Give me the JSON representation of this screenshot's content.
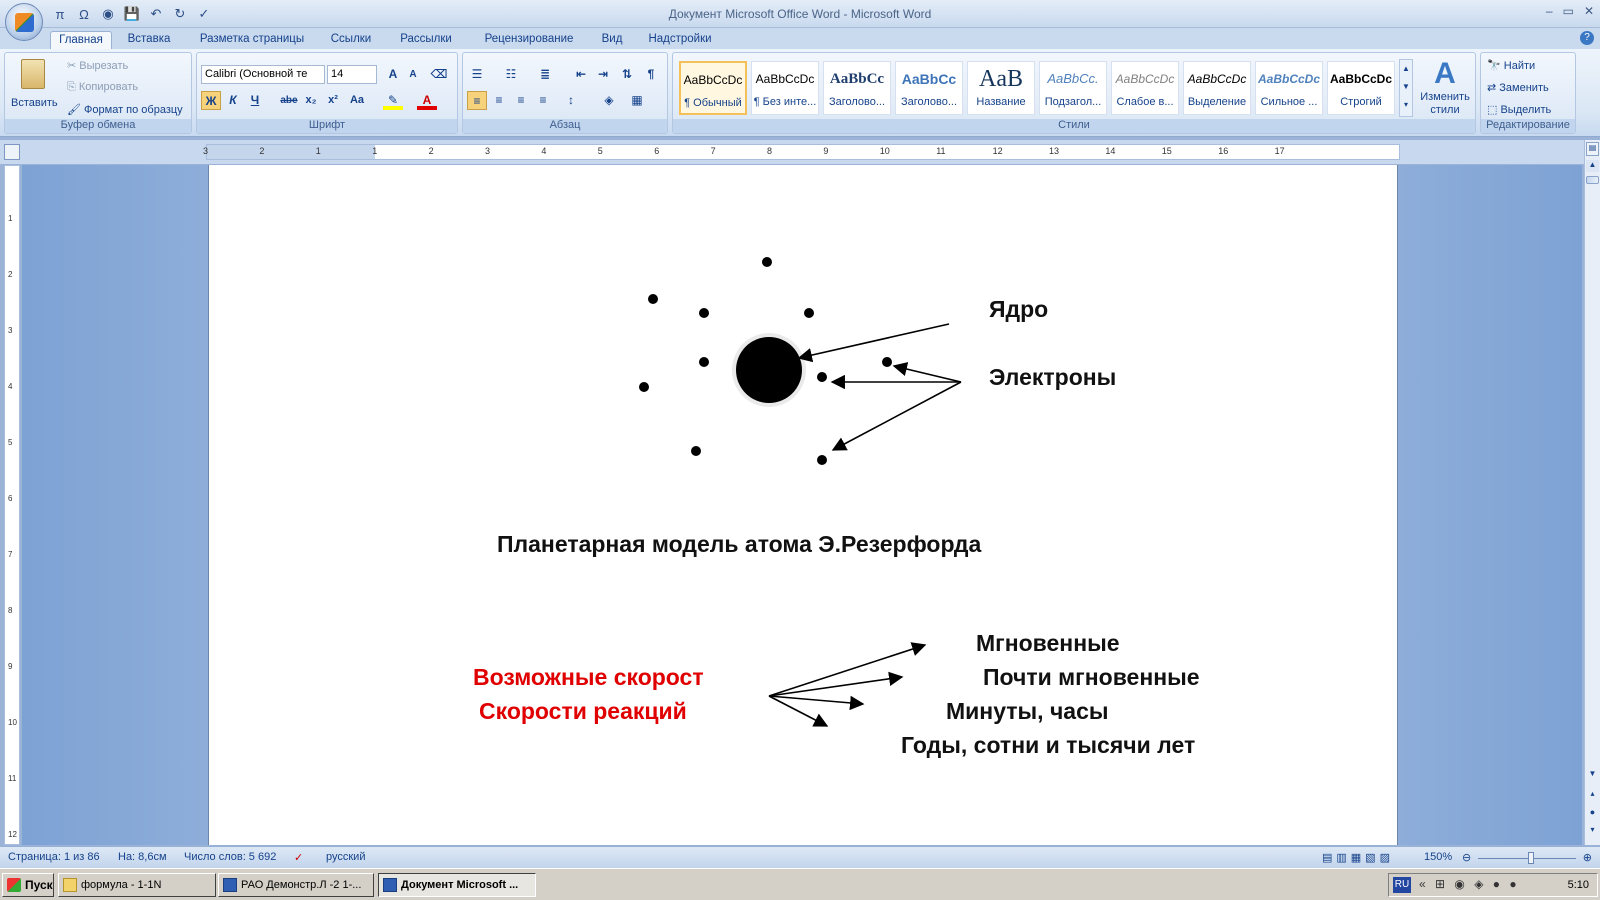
{
  "window": {
    "title": "Документ Microsoft Office Word - Microsoft Word",
    "controls": [
      "–",
      "▭",
      "✕"
    ]
  },
  "quick_access": [
    "π",
    "Ω",
    "◉",
    "💾",
    "↶",
    "↻",
    "✓"
  ],
  "tabs": [
    "Главная",
    "Вставка",
    "Разметка страницы",
    "Ссылки",
    "Рассылки",
    "Рецензирование",
    "Вид",
    "Надстройки"
  ],
  "ribbon": {
    "clipboard": {
      "paste": "Вставить",
      "cut": "Вырезать",
      "copy": "Копировать",
      "format_painter": "Формат по образцу",
      "label": "Буфер обмена"
    },
    "font": {
      "name": "Calibri (Основной те",
      "size": "14",
      "label": "Шрифт",
      "bold": "Ж",
      "italic": "К",
      "underline": "Ч",
      "strike": "abe",
      "sub": "x₂",
      "sup": "x²",
      "case": "Aa",
      "grow": "A",
      "shrink": "A"
    },
    "paragraph": {
      "label": "Абзац"
    },
    "styles": {
      "label": "Стили",
      "tiles": [
        {
          "sample": "AaBbCcDc",
          "name": "¶ Обычный"
        },
        {
          "sample": "AaBbCcDc",
          "name": "¶ Без инте..."
        },
        {
          "sample": "AaBbCc",
          "name": "Заголово..."
        },
        {
          "sample": "AaBbCc",
          "name": "Заголово..."
        },
        {
          "sample": "AaB",
          "name": "Название"
        },
        {
          "sample": "AaBbCc.",
          "name": "Подзагол..."
        },
        {
          "sample": "AaBbCcDc",
          "name": "Слабое в..."
        },
        {
          "sample": "AaBbCcDc",
          "name": "Выделение"
        },
        {
          "sample": "AaBbCcDc",
          "name": "Сильное ..."
        },
        {
          "sample": "AaBbCcDc",
          "name": "Строгий"
        }
      ],
      "change": "Изменить стили"
    },
    "editing": {
      "find": "Найти",
      "replace": "Заменить",
      "select": "Выделить",
      "label": "Редактирование"
    }
  },
  "ruler": {
    "h_numbers": [
      "3",
      "2",
      "1",
      "1",
      "2",
      "3",
      "4",
      "5",
      "6",
      "7",
      "8",
      "9",
      "10",
      "11",
      "12",
      "13",
      "14",
      "15",
      "16",
      "17"
    ],
    "v_numbers": [
      "1",
      "2",
      "3",
      "4",
      "5",
      "6",
      "7",
      "8",
      "9",
      "10",
      "11",
      "12"
    ]
  },
  "document": {
    "nucleus_label": "Ядро",
    "electrons_label": "Электроны",
    "caption": "Планетарная модель атома Э.Резерфорда",
    "red_line1": "Возможные скорост",
    "red_line2": "Скорости реакций",
    "speed1": "Мгновенные",
    "speed2": "Почти мгновенные",
    "speed3": "Минуты, часы",
    "speed4": "Годы, сотни и тысячи лет"
  },
  "status": {
    "page": "Страница: 1 из 86",
    "position": "На: 8,6см",
    "words": "Число слов: 5 692",
    "language": "русский",
    "zoom": "150%"
  },
  "taskbar": {
    "start": "Пуск",
    "items": [
      "формула - 1-1N",
      "РАО Демонстр.Л -2   1-...",
      "Документ Microsoft ..."
    ],
    "lang": "RU",
    "clock": "5:10"
  },
  "colors": {
    "ribbon_bg": "#dbe7f5",
    "doc_red": "#e00000",
    "workspace": "#9ab5dd"
  }
}
